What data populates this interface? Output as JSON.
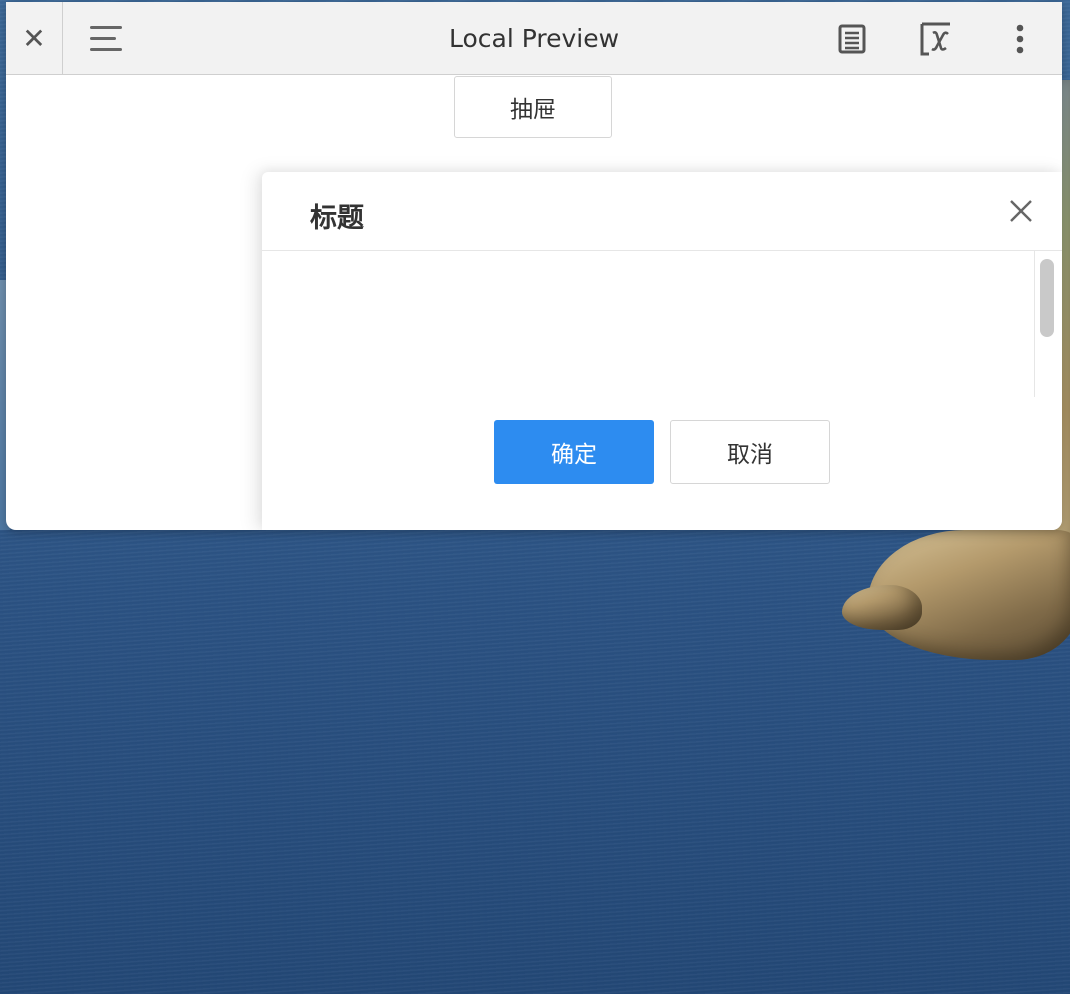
{
  "window": {
    "title": "Local Preview",
    "close_glyph": "✕",
    "icons": [
      "close-icon",
      "hamburger-menu-icon",
      "document-icon",
      "function-x-icon",
      "more-vertical-icon"
    ]
  },
  "page": {
    "drawer_button_label": "抽屉"
  },
  "drawer": {
    "title": "标题",
    "ok_label": "确定",
    "cancel_label": "取消",
    "colors": {
      "primary": "#2d8cf0",
      "border": "#d6d6d6",
      "text": "#333333"
    }
  }
}
